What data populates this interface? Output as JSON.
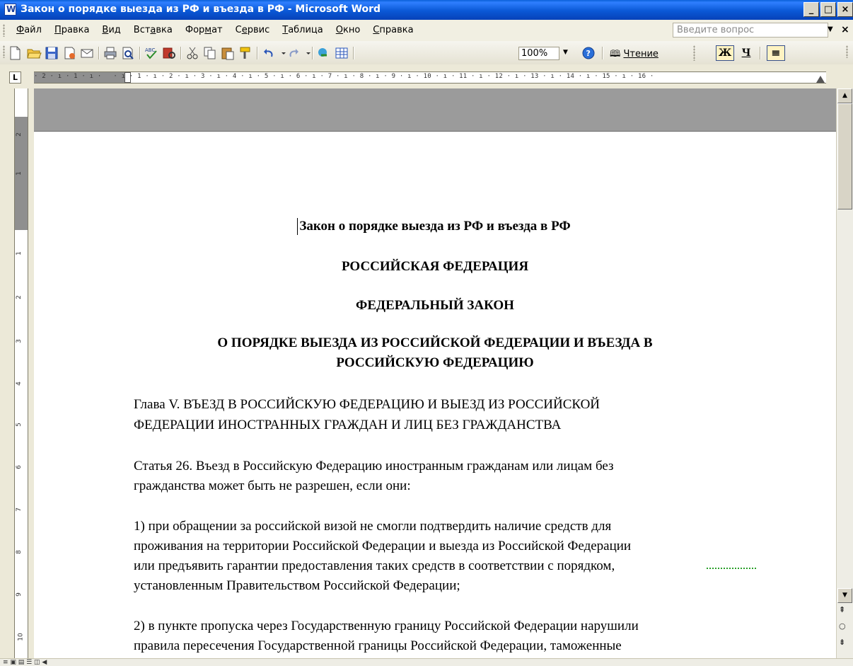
{
  "window": {
    "title": "Закон о порядке выезда из РФ и въезда в РФ - Microsoft Word"
  },
  "menu": [
    {
      "pre": "",
      "u": "Ф",
      "post": "айл"
    },
    {
      "pre": "",
      "u": "П",
      "post": "равка"
    },
    {
      "pre": "",
      "u": "В",
      "post": "ид"
    },
    {
      "pre": "Вст",
      "u": "а",
      "post": "вка"
    },
    {
      "pre": "Фор",
      "u": "м",
      "post": "ат"
    },
    {
      "pre": "С",
      "u": "е",
      "post": "рвис"
    },
    {
      "pre": "",
      "u": "Т",
      "post": "аблица"
    },
    {
      "pre": "",
      "u": "О",
      "post": "кно"
    },
    {
      "pre": "",
      "u": "С",
      "post": "правка"
    }
  ],
  "help": {
    "placeholder": "Введите вопрос"
  },
  "toolbar": {
    "zoom": "100%",
    "read_label": "Чтение",
    "bold": "Ж",
    "underline": "Ч"
  },
  "ruler": {
    "text": "· 2 · ı · 1 · ı ·   · ı · 1 · ı · 2 · ı · 3 · ı · 4 · ı · 5 · ı · 6 · ı · 7 · ı · 8 · ı · 9 · ı · 10 · ı · 11 · ı · 12 · ı · 13 · ı · 14 · ı · 15 · ı · 16 ·"
  },
  "document": {
    "title": "Закон о порядке выезда из РФ и въезда в РФ",
    "h1": "РОССИЙСКАЯ ФЕДЕРАЦИЯ",
    "h2": "ФЕДЕРАЛЬНЫЙ ЗАКОН",
    "h3_line1": "О ПОРЯДКЕ ВЫЕЗДА ИЗ РОССИЙСКОЙ ФЕДЕРАЦИИ И ВЪЕЗДА В",
    "h3_line2": "РОССИЙСКУЮ ФЕДЕРАЦИЮ",
    "chapter_line1": "Глава V. ВЪЕЗД В РОССИЙСКУЮ ФЕДЕРАЦИЮ И ВЫЕЗД ИЗ РОССИЙСКОЙ",
    "chapter_line2": "ФЕДЕРАЦИИ ИНОСТРАННЫХ ГРАЖДАН И ЛИЦ БЕЗ ГРАЖДАНСТВА",
    "article_line1": "Статья 26. Въезд в Российскую Федерацию иностранным гражданам или лицам без",
    "article_line2": "гражданства может быть не разрешен, если они:",
    "p1_line1": "1) при обращении за российской визой не смогли подтвердить наличие средств для",
    "p1_line2": "проживания на территории Российской Федерации и выезда из Российской Федерации",
    "p1_line3": "или предъявить гарантии предоставления таких средств в соответствии с порядком,",
    "p1_line4": "установленным Правительством Российской Федерации;",
    "p2_line1": "2) в пункте пропуска через Государственную границу Российской Федерации нарушили",
    "p2_line2": "правила пересечения Государственной границы Российской Федерации, таможенные"
  }
}
